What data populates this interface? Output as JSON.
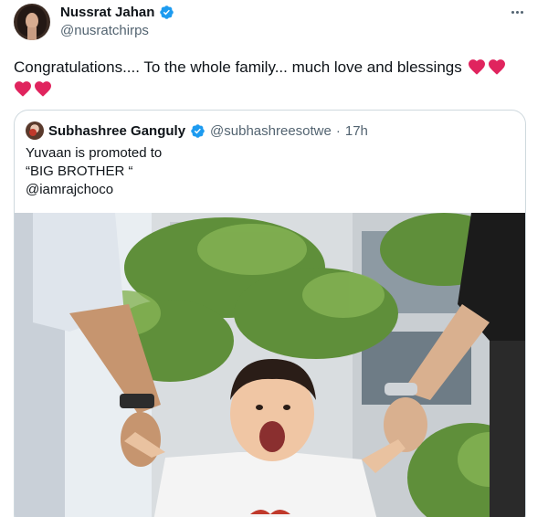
{
  "tweet": {
    "display_name": "Nussrat Jahan",
    "handle": "@nusratchirps",
    "text": "Congratulations.... To the whole family... much love and blessings",
    "hearts_line1": 2,
    "hearts_line2": 2
  },
  "quoted_tweet": {
    "display_name": "Subhashree Ganguly",
    "handle": "@subhashreesotwe",
    "separator": "·",
    "time": "17h",
    "lines": [
      "Yuvaan is promoted to",
      "“BIG BROTHER “",
      "@iamrajchoco"
    ]
  },
  "icons": {
    "verified": "verified-badge-icon",
    "more": "more-options-icon",
    "heart": "red-heart-emoji"
  },
  "colors": {
    "verified": "#1d9bf0",
    "heart": "#e0245e",
    "secondary_text": "#536471",
    "border": "#cfd9de"
  }
}
